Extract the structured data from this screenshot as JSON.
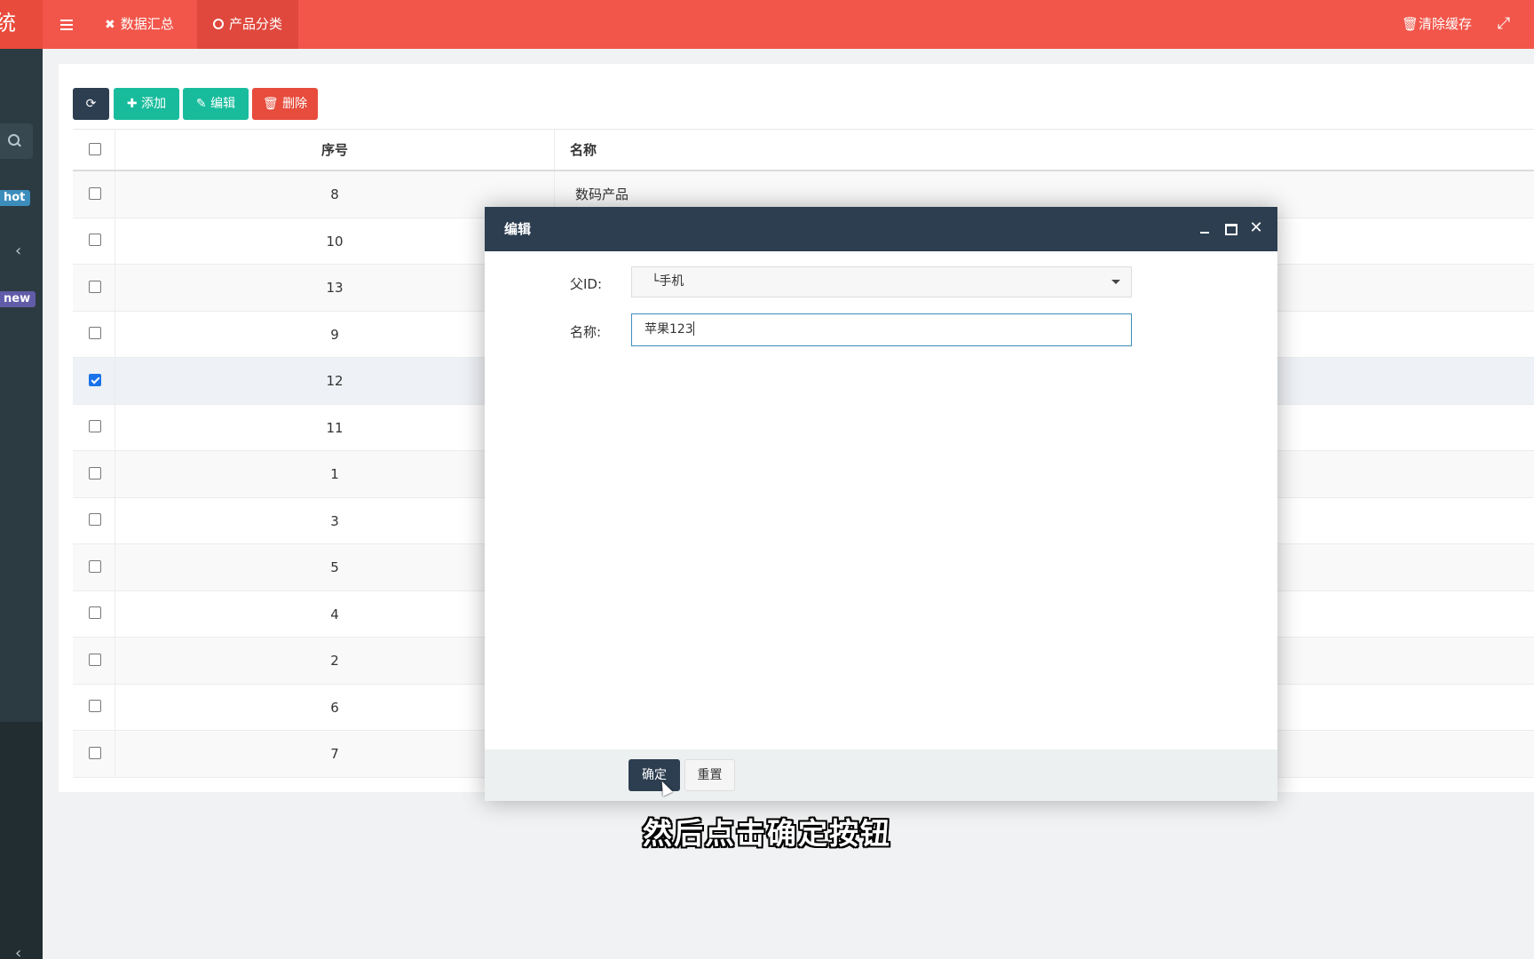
{
  "header": {
    "logo_text": "统",
    "tabs": [
      {
        "label": "数据汇总",
        "icon": "dashboard-icon"
      },
      {
        "label": "产品分类",
        "icon": "circle-icon"
      }
    ],
    "clear_cache": "清除缓存",
    "fullscreen_icon": "expand-icon",
    "accent_color": "#f2564a"
  },
  "sidebar": {
    "badges": {
      "hot": "hot",
      "new": "new"
    },
    "collapse_icon": "chevron-left-icon"
  },
  "toolbar": {
    "refresh_icon": "refresh-icon",
    "add_label": "✚ 添加",
    "edit_label": "✎ 编辑",
    "delete_label": "🗑 删除"
  },
  "table": {
    "columns": [
      "序号",
      "名称"
    ],
    "rows": [
      {
        "id": "8",
        "name": "数码产品",
        "checked": false
      },
      {
        "id": "10",
        "name": "",
        "checked": false
      },
      {
        "id": "13",
        "name": "",
        "checked": false
      },
      {
        "id": "9",
        "name": "",
        "checked": false
      },
      {
        "id": "12",
        "name": "",
        "checked": true
      },
      {
        "id": "11",
        "name": "",
        "checked": false
      },
      {
        "id": "1",
        "name": "",
        "checked": false
      },
      {
        "id": "3",
        "name": "",
        "checked": false
      },
      {
        "id": "5",
        "name": "",
        "checked": false
      },
      {
        "id": "4",
        "name": "",
        "checked": false
      },
      {
        "id": "2",
        "name": "",
        "checked": false
      },
      {
        "id": "6",
        "name": "",
        "checked": false
      },
      {
        "id": "7",
        "name": "",
        "checked": false
      }
    ]
  },
  "modal": {
    "title": "编辑",
    "parent_label": "父ID:",
    "parent_value": "└手机",
    "name_label": "名称:",
    "name_value": "苹果123",
    "ok_label": "确定",
    "reset_label": "重置"
  },
  "subtitle": "然后点击确定按钮"
}
